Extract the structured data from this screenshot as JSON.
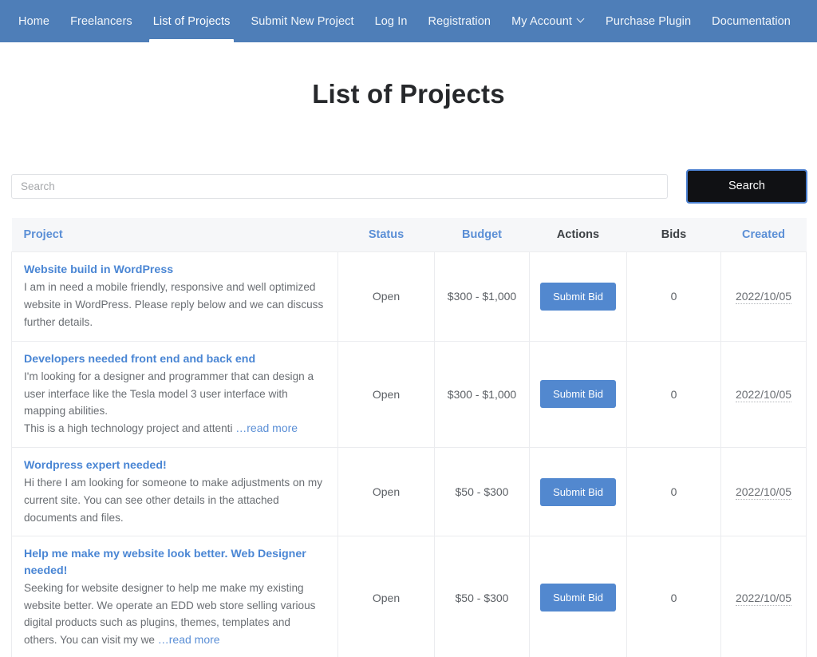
{
  "nav": {
    "items": [
      {
        "label": "Home",
        "active": false,
        "dropdown": false
      },
      {
        "label": "Freelancers",
        "active": false,
        "dropdown": false
      },
      {
        "label": "List of Projects",
        "active": true,
        "dropdown": false
      },
      {
        "label": "Submit New Project",
        "active": false,
        "dropdown": false
      },
      {
        "label": "Log In",
        "active": false,
        "dropdown": false
      },
      {
        "label": "Registration",
        "active": false,
        "dropdown": false
      },
      {
        "label": "My Account",
        "active": false,
        "dropdown": true
      },
      {
        "label": "Purchase Plugin",
        "active": false,
        "dropdown": false
      },
      {
        "label": "Documentation",
        "active": false,
        "dropdown": false
      }
    ]
  },
  "header": {
    "title": "List of Projects"
  },
  "search": {
    "placeholder": "Search",
    "value": "",
    "button_label": "Search"
  },
  "table": {
    "columns": [
      {
        "key": "project",
        "label": "Project",
        "sortable": true
      },
      {
        "key": "status",
        "label": "Status",
        "sortable": true
      },
      {
        "key": "budget",
        "label": "Budget",
        "sortable": true
      },
      {
        "key": "actions",
        "label": "Actions",
        "sortable": false
      },
      {
        "key": "bids",
        "label": "Bids",
        "sortable": false
      },
      {
        "key": "created",
        "label": "Created",
        "sortable": true
      }
    ],
    "rows": [
      {
        "title": "Website build in WordPress",
        "description": "I am in need a mobile friendly, responsive and well optimized website in WordPress. Please reply below and we can discuss further details.",
        "truncated": false,
        "read_more": "",
        "status": "Open",
        "budget": "$300 - $1,000",
        "action_label": "Submit Bid",
        "bids": "0",
        "created": "2022/10/05"
      },
      {
        "title": "Developers needed front end and back end",
        "description": "I'm looking for a designer and programmer that can design a user interface like the Tesla model 3 user interface with mapping abilities.\nThis is a high technology project and attenti ",
        "truncated": true,
        "read_more": "…read more",
        "status": "Open",
        "budget": "$300 - $1,000",
        "action_label": "Submit Bid",
        "bids": "0",
        "created": "2022/10/05"
      },
      {
        "title": "Wordpress expert needed!",
        "description": "Hi there I am looking for someone to make adjustments on my current site. You can see other details in the attached documents and files.",
        "truncated": false,
        "read_more": "",
        "status": "Open",
        "budget": "$50 - $300",
        "action_label": "Submit Bid",
        "bids": "0",
        "created": "2022/10/05"
      },
      {
        "title": "Help me make my website look better. Web Designer needed!",
        "description": "Seeking for website designer to help me make my existing website better. We operate an EDD web store selling various digital products such as plugins, themes, templates and others. You can visit my we ",
        "truncated": true,
        "read_more": "…read more",
        "status": "Open",
        "budget": "$50 - $300",
        "action_label": "Submit Bid",
        "bids": "0",
        "created": "2022/10/05"
      }
    ]
  },
  "colors": {
    "nav_bg": "#4e7eb8",
    "link_blue": "#4a86d4",
    "header_blue": "#5b8fd6",
    "bid_button": "#5288cf",
    "search_button": "#101114",
    "table_header_bg": "#f6f7f9"
  }
}
